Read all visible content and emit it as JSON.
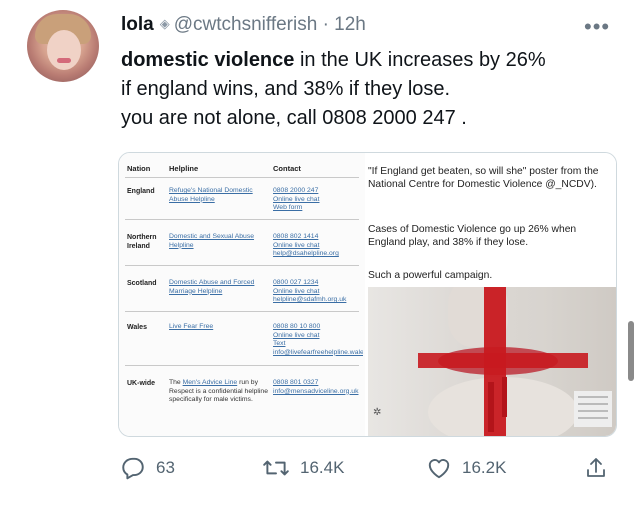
{
  "tweet": {
    "display_name": "lola",
    "handle": "@cwtchsnifferish",
    "separator": "·",
    "time": "12h",
    "more": "•••",
    "text_bold": "domestic violence",
    "text_rest_1": " in the UK increases by 26%",
    "text_line_2": "if england wins, and 38% if they lose.",
    "text_line_3": "you are not alone, call 0808 2000 247 ."
  },
  "media": {
    "table": {
      "headers": [
        "Nation",
        "Helpline",
        "Contact"
      ],
      "rows": [
        {
          "nation": "England",
          "helpline": "Refuge's National Domestic Abuse Helpline",
          "contact": [
            "0808 2000 247",
            "Online live chat",
            "Web form"
          ]
        },
        {
          "nation": "Northern Ireland",
          "helpline": "Domestic and Sexual Abuse Helpline",
          "contact": [
            "0808 802 1414",
            "Online live chat",
            "help@dsahelpline.org"
          ]
        },
        {
          "nation": "Scotland",
          "helpline": "Domestic Abuse and Forced Marriage Helpline",
          "contact": [
            "0800 027 1234",
            "Online live chat",
            "helpline@sdafmh.org.uk"
          ]
        },
        {
          "nation": "Wales",
          "helpline": "Live Fear Free",
          "contact": [
            "0808 80 10 800",
            "Online live chat",
            "Text",
            "info@livefearfreehelpline.wales"
          ]
        },
        {
          "nation": "UK-wide",
          "helpline_pre": "The ",
          "helpline_link": "Men's Advice Line",
          "helpline_post": " run by Respect is a confidential helpline specifically for male victims.",
          "contact": [
            "0808 801 0327",
            "info@mensadviceline.org.uk"
          ]
        }
      ]
    },
    "caption": {
      "line1": "\"If England get beaten, so will she\" poster from the National Centre for Domestic Violence @_NCDV).",
      "line2": "Cases of Domestic Violence go up 26% when England play, and 38% if they lose.",
      "line3": "Such a powerful campaign."
    }
  },
  "actions": {
    "replies": "63",
    "retweets": "16.4K",
    "likes": "16.2K"
  },
  "colors": {
    "text": "#0f1419",
    "secondary": "#536471",
    "link": "#3a6ea5",
    "flag_red": "#c8191f"
  }
}
